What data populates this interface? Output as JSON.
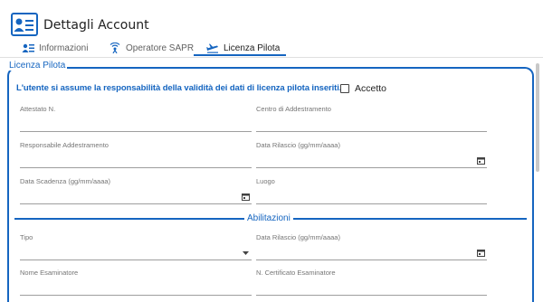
{
  "header": {
    "title": "Dettagli Account",
    "icon": "account-card-icon"
  },
  "tabs": [
    {
      "label": "Informazioni",
      "icon": "list-person-icon"
    },
    {
      "label": "Operatore SAPR",
      "icon": "drone-signal-icon"
    },
    {
      "label": "Licenza Pilota",
      "icon": "plane-icon"
    }
  ],
  "active_tab": "Licenza Pilota",
  "section": {
    "legend": "Licenza Pilota",
    "notice": "L'utente si assume la responsabilità della validità dei dati di licenza pilota inseriti.",
    "accept_label": "Accetto",
    "accept_checked": false,
    "fields": {
      "attestato": {
        "label": "Attestato N.",
        "value": ""
      },
      "centro": {
        "label": "Centro di Addestramento",
        "value": ""
      },
      "responsabile": {
        "label": "Responsabile Addestramento",
        "value": ""
      },
      "data_rilascio": {
        "label": "Data Rilascio (gg/mm/aaaa)",
        "value": ""
      },
      "data_scadenza": {
        "label": "Data Scadenza (gg/mm/aaaa)",
        "value": ""
      },
      "luogo": {
        "label": "Luogo",
        "value": ""
      }
    }
  },
  "abilitazioni": {
    "legend": "Abilitazioni",
    "fields": {
      "tipo": {
        "label": "Tipo",
        "value": ""
      },
      "data_rilascio": {
        "label": "Data Rilascio (gg/mm/aaaa)",
        "value": ""
      },
      "nome_esaminatore": {
        "label": "Nome Esaminatore",
        "value": ""
      },
      "certificato": {
        "label": "N. Certificato Esaminatore",
        "value": ""
      }
    }
  },
  "colors": {
    "accent": "#1565c0",
    "text": "#212121",
    "muted": "#757575"
  }
}
